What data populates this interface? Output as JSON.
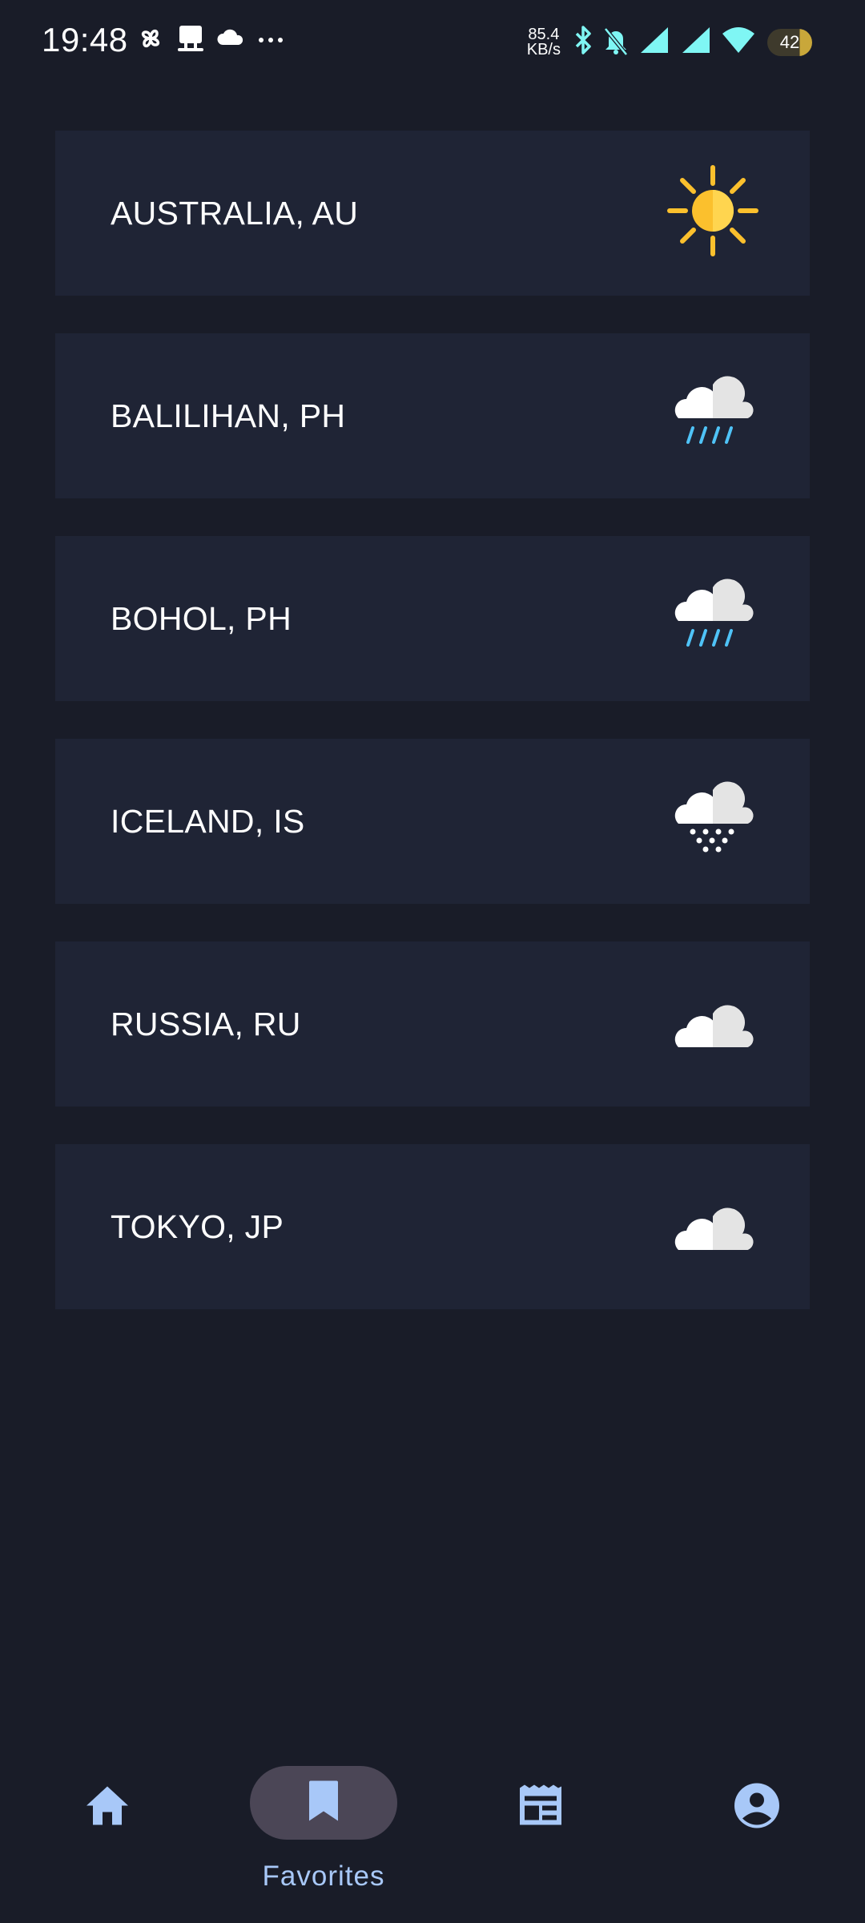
{
  "status_bar": {
    "time": "19:48",
    "net_speed_value": "85.4",
    "net_speed_unit": "KB/s",
    "battery": "42",
    "icons": [
      "pinwheel-icon",
      "notification-app-icon",
      "cloud-icon",
      "more-dots-icon",
      "bluetooth-icon",
      "silent-bell-icon",
      "signal-icon",
      "signal-icon",
      "wifi-icon",
      "battery-icon"
    ]
  },
  "locations": [
    {
      "name": "AUSTRALIA, AU",
      "weather": "sunny"
    },
    {
      "name": "BALILIHAN, PH",
      "weather": "rain"
    },
    {
      "name": "BOHOL, PH",
      "weather": "rain"
    },
    {
      "name": "ICELAND, IS",
      "weather": "snow"
    },
    {
      "name": "RUSSIA, RU",
      "weather": "cloudy"
    },
    {
      "name": "TOKYO, JP",
      "weather": "cloudy"
    }
  ],
  "bottom_nav": {
    "items": [
      {
        "id": "home",
        "label": "",
        "icon": "home-icon"
      },
      {
        "id": "favorites",
        "label": "Favorites",
        "icon": "bookmark-icon",
        "active": true
      },
      {
        "id": "news",
        "label": "",
        "icon": "newspaper-icon"
      },
      {
        "id": "profile",
        "label": "",
        "icon": "account-circle-icon"
      }
    ]
  },
  "colors": {
    "background": "#191c28",
    "card": "#1f2435",
    "accent": "#a8c8f8",
    "active_pill": "#4b4656",
    "sun": "#fbc02d",
    "rain": "#4fc3f7"
  }
}
